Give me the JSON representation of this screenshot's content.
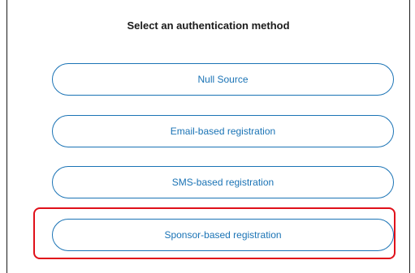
{
  "title": "Select an authentication method",
  "methods": [
    {
      "label": "Null Source"
    },
    {
      "label": "Email-based registration"
    },
    {
      "label": "SMS-based registration"
    },
    {
      "label": "Sponsor-based registration",
      "highlighted": true
    }
  ],
  "colors": {
    "accent": "#1a73b5",
    "highlight": "#e0101a",
    "text": "#1a1a1a"
  }
}
